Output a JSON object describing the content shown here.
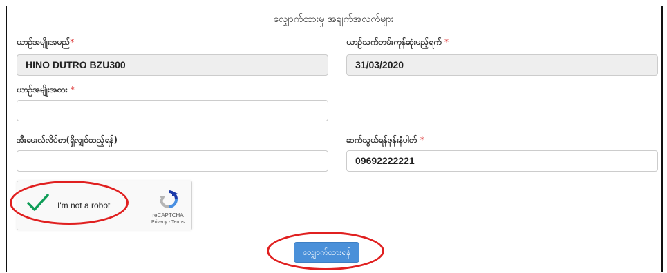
{
  "form": {
    "title": "လျှောက်ထားမှု အချက်အလက်များ",
    "required_marker": "*",
    "fields": {
      "car_name": {
        "label": "ယာဉ်အမျိုးအမည်",
        "value": "HINO DUTRO BZU300"
      },
      "expiry_date": {
        "label": "ယာဉ်သက်တမ်းကုန်ဆုံးမည့်ရက်",
        "value": "31/03/2020"
      },
      "car_type": {
        "label": "ယာဉ်အမျိုးအစား",
        "value": ""
      },
      "email": {
        "label": "အီးမေးလ်လိပ်စာ(ရှိလျှင်ထည့်ရန်)",
        "value": ""
      },
      "phone": {
        "label": "ဆက်သွယ်ရန်ဖုန်းနံပါတ်",
        "value": "09692222221"
      }
    },
    "captcha": {
      "checkbox_label": "I'm not a robot",
      "brand": "reCAPTCHA",
      "privacy_link": "Privacy",
      "separator": " - ",
      "terms_link": "Terms",
      "checked": true
    },
    "submit_label": "လျှောက်ထားရန်"
  },
  "colors": {
    "annotation_ellipse": "#e02020",
    "submit_button": "#4a90d9",
    "check_mark": "#0f9d58",
    "required": "#d33333"
  }
}
